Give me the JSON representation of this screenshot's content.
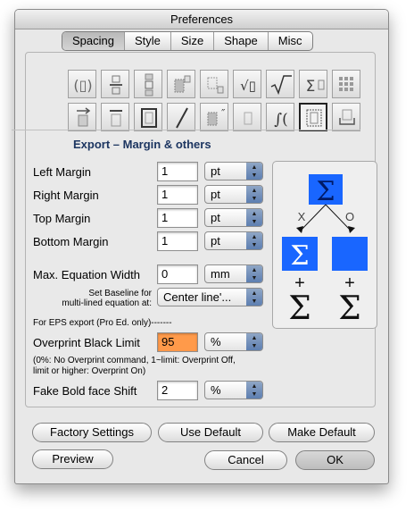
{
  "window": {
    "title": "Preferences"
  },
  "tabs": [
    "Spacing",
    "Style",
    "Size",
    "Shape",
    "Misc"
  ],
  "active_tab": "Spacing",
  "section": {
    "title": "Export – Margin & others"
  },
  "margins": [
    {
      "label": "Left Margin",
      "value": "1",
      "unit": "pt"
    },
    {
      "label": "Right Margin",
      "value": "1",
      "unit": "pt"
    },
    {
      "label": "Top Margin",
      "value": "1",
      "unit": "pt"
    },
    {
      "label": "Bottom Margin",
      "value": "1",
      "unit": "pt"
    }
  ],
  "max_width": {
    "label": "Max. Equation Width",
    "value": "0",
    "unit": "mm"
  },
  "baseline": {
    "label_line1": "Set Baseline for",
    "label_line2": "multi-lined equation at:",
    "value": "Center line'..."
  },
  "eps_note": "For EPS export (Pro Ed. only)-------",
  "overprint": {
    "label": "Overprint Black Limit",
    "value": "95",
    "unit": "%",
    "note_line1": "(0%: No Overprint command, 1~limit: Overprint Off,",
    "note_line2": "limit or higher: Overprint On)"
  },
  "fake_bold": {
    "label": "Fake Bold face Shift",
    "value": "2",
    "unit": "%"
  },
  "diagram": {
    "symbol": "Σ",
    "branch_left": "X",
    "branch_right": "O",
    "plus": "+"
  },
  "buttons": {
    "factory": "Factory Settings",
    "use_default": "Use Default",
    "make_default": "Make Default",
    "preview": "Preview",
    "cancel": "Cancel",
    "ok": "OK"
  },
  "colors": {
    "accent_blue": "#1966ff",
    "highlight_field": "#ff9a4a",
    "section_title": "#1d3661"
  }
}
